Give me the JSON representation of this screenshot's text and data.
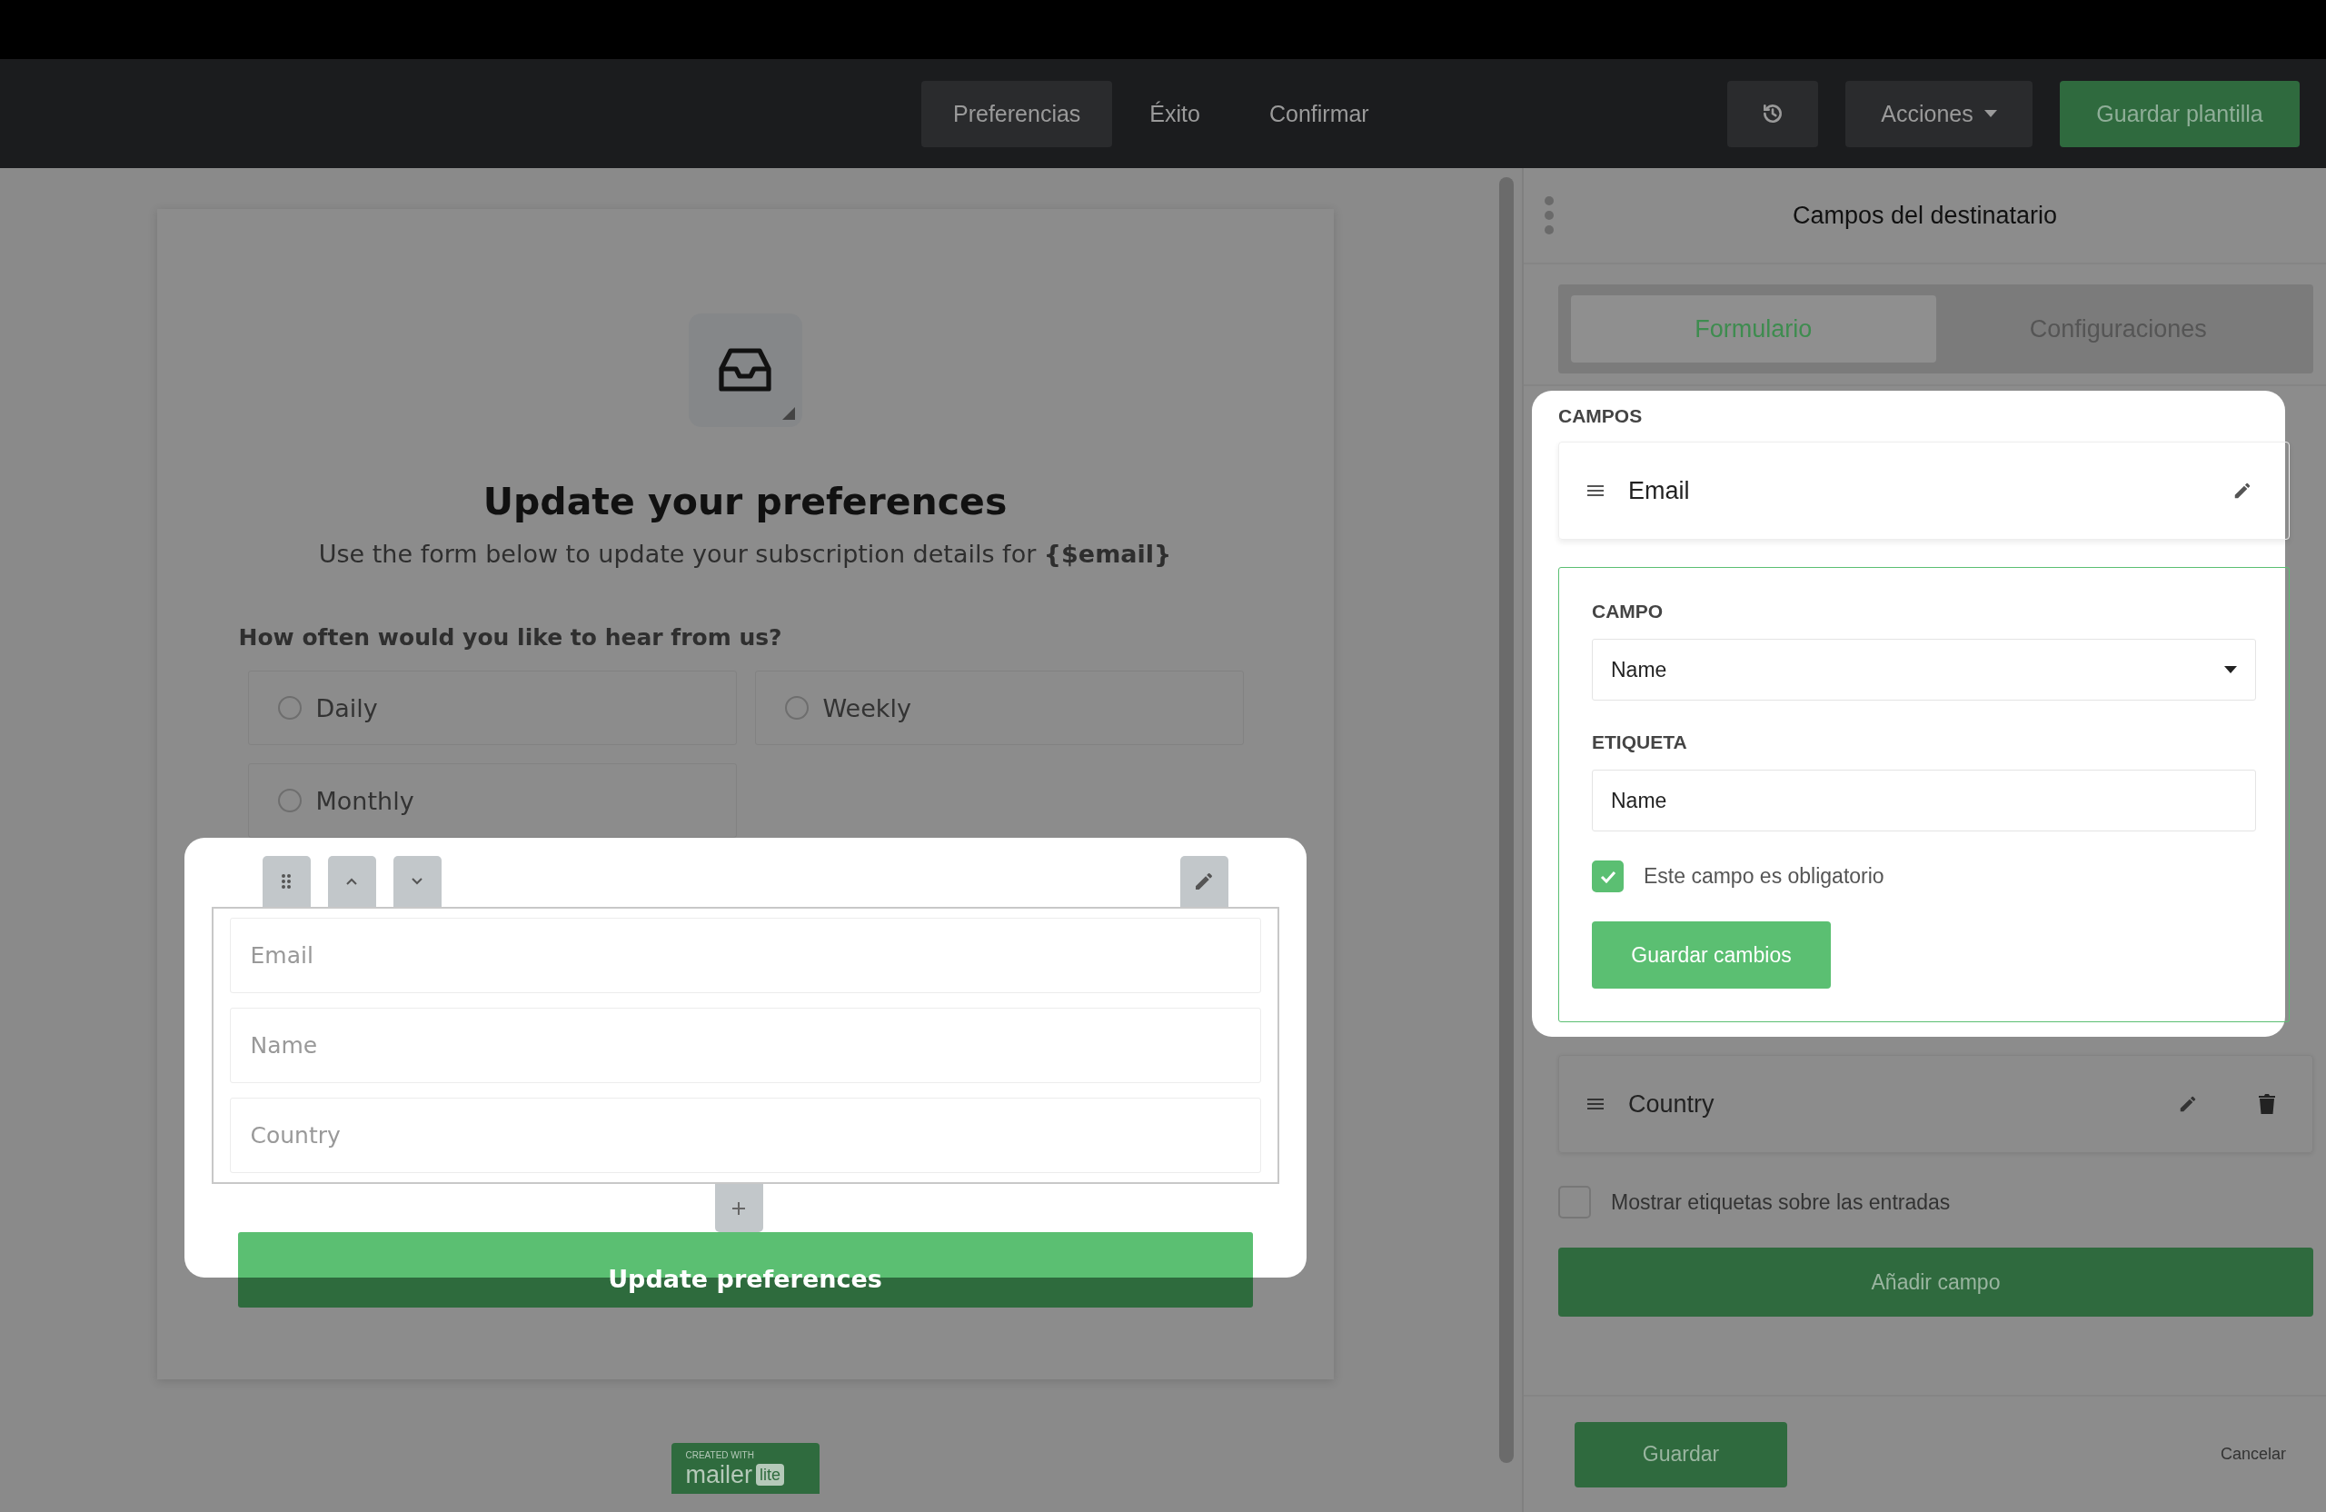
{
  "nav": {
    "tabs": [
      {
        "label": "Preferencias",
        "selected": true
      },
      {
        "label": "Éxito",
        "selected": false
      },
      {
        "label": "Confirmar",
        "selected": false
      }
    ],
    "actions": "Acciones",
    "save_template": "Guardar plantilla"
  },
  "form": {
    "title": "Update your preferences",
    "subtitle": "Use the form below to update your subscription details for **{$email}**",
    "question": "How often would you like to hear from us?",
    "options": [
      {
        "label": "Daily",
        "selected": false
      },
      {
        "label": "Weekly",
        "selected": false
      },
      {
        "label": "Monthly",
        "selected": false
      }
    ],
    "fields": [
      {
        "placeholder": "Email"
      },
      {
        "placeholder": "Name"
      },
      {
        "placeholder": "Country"
      }
    ],
    "submit": "Update preferences"
  },
  "badge": {
    "caption": "CREATED WITH",
    "brand": "mailer",
    "brand_tag": "lite"
  },
  "panel": {
    "title": "Campos del destinatario",
    "tabs": [
      {
        "label": "Formulario",
        "selected": true
      },
      {
        "label": "Configuraciones",
        "selected": false
      }
    ],
    "section_label": "CAMPOS",
    "fields": [
      {
        "label": "Email",
        "deletable": false
      },
      {
        "label": "Country",
        "deletable": true
      }
    ],
    "editor": {
      "field_heading": "CAMPO",
      "field_value": "Name",
      "label_heading": "ETIQUETA",
      "label_value": "Name",
      "required_text": "Este campo es obligatorio",
      "required": true,
      "save": "Guardar cambios"
    },
    "show_labels": {
      "label": "Mostrar etiquetas sobre las entradas",
      "checked": false
    },
    "add_field": "Añadir campo",
    "footer": {
      "save": "Guardar",
      "cancel": "Cancelar"
    }
  }
}
